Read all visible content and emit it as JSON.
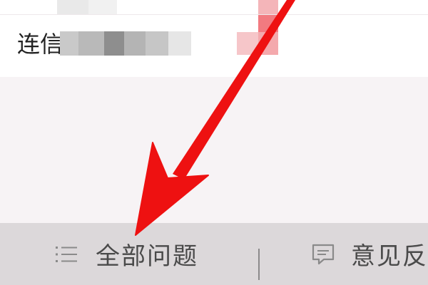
{
  "list": {
    "row_label": "连信"
  },
  "bottom_bar": {
    "tabs": [
      {
        "label": "全部问题",
        "icon": "list-icon"
      },
      {
        "label": "意见反",
        "icon": "chat-icon"
      }
    ]
  },
  "colors": {
    "accent_arrow": "#ee1111",
    "tab_bar": "#dcd8da",
    "page_bg": "#f7f3f5",
    "card_bg": "#ffffff"
  }
}
